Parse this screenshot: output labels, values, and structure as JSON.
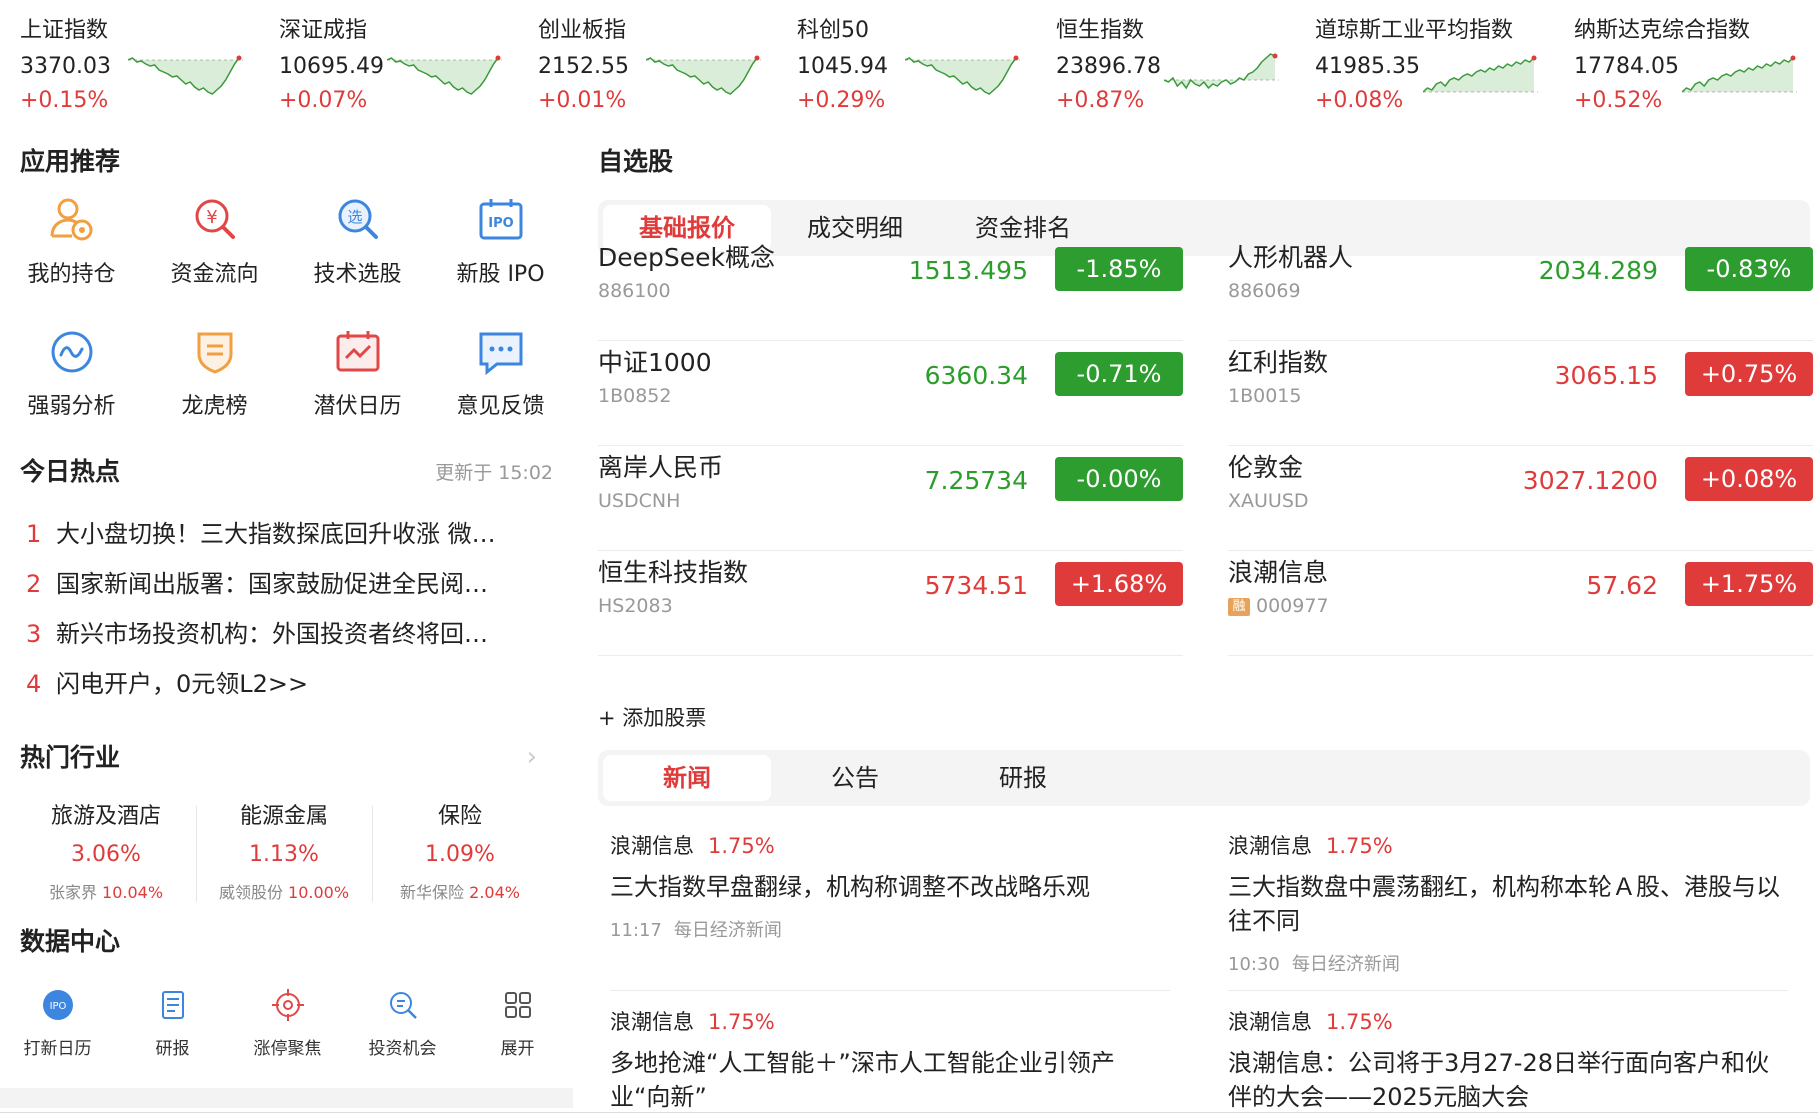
{
  "indices": [
    {
      "name": "上证指数",
      "value": "3370.03",
      "change": "+0.15%",
      "trend": "dip-recover"
    },
    {
      "name": "深证成指",
      "value": "10695.49",
      "change": "+0.07%",
      "trend": "dip-recover"
    },
    {
      "name": "创业板指",
      "value": "2152.55",
      "change": "+0.01%",
      "trend": "dip-recover"
    },
    {
      "name": "科创50",
      "value": "1045.94",
      "change": "+0.29%",
      "trend": "dip-recover"
    },
    {
      "name": "恒生指数",
      "value": "23896.78",
      "change": "+0.87%",
      "trend": "flat-spike"
    },
    {
      "name": "道琼斯工业平均指数",
      "value": "41985.35",
      "change": "+0.08%",
      "trend": "rise"
    },
    {
      "name": "纳斯达克综合指数",
      "value": "17784.05",
      "change": "+0.52%",
      "trend": "rise"
    }
  ],
  "apps": {
    "title": "应用推荐",
    "items": [
      {
        "label": "我的持仓",
        "icon": "user-holdings-icon"
      },
      {
        "label": "资金流向",
        "icon": "money-search-icon"
      },
      {
        "label": "技术选股",
        "icon": "stock-select-icon"
      },
      {
        "label": "新股 IPO",
        "icon": "ipo-icon"
      },
      {
        "label": "强弱分析",
        "icon": "wave-analysis-icon"
      },
      {
        "label": "龙虎榜",
        "icon": "shield-rank-icon"
      },
      {
        "label": "潜伏日历",
        "icon": "calendar-check-icon"
      },
      {
        "label": "意见反馈",
        "icon": "feedback-icon"
      }
    ]
  },
  "hot": {
    "title": "今日热点",
    "updated": "更新于 15:02",
    "items": [
      {
        "num": "1",
        "text": "大小盘切换！三大指数探底回升收涨 微…"
      },
      {
        "num": "2",
        "text": "国家新闻出版署：国家鼓励促进全民阅…"
      },
      {
        "num": "3",
        "text": "新兴市场投资机构：外国投资者终将回…"
      },
      {
        "num": "4",
        "text": "闪电开户，0元领L2>>"
      }
    ]
  },
  "industry": {
    "title": "热门行业",
    "arrow": "›",
    "items": [
      {
        "name": "旅游及酒店",
        "change": "3.06%",
        "leader": "张家界",
        "leader_change": "10.04%"
      },
      {
        "name": "能源金属",
        "change": "1.13%",
        "leader": "威领股份",
        "leader_change": "10.00%"
      },
      {
        "name": "保险",
        "change": "1.09%",
        "leader": "新华保险",
        "leader_change": "2.04%"
      }
    ]
  },
  "data_center": {
    "title": "数据中心",
    "items": [
      {
        "label": "打新日历",
        "icon": "ipo-badge-icon"
      },
      {
        "label": "研报",
        "icon": "report-icon"
      },
      {
        "label": "涨停聚焦",
        "icon": "target-icon"
      },
      {
        "label": "投资机会",
        "icon": "opportunity-search-icon"
      },
      {
        "label": "展开",
        "icon": "grid-expand-icon"
      }
    ]
  },
  "watchlist": {
    "title": "自选股",
    "tabs": [
      "基础报价",
      "成交明细",
      "资金排名"
    ],
    "active_tab": 0,
    "quotes": [
      {
        "name": "DeepSeek概念",
        "code": "886100",
        "price": "1513.495",
        "change": "-1.85%",
        "dir": "down"
      },
      {
        "name": "人形机器人",
        "code": "886069",
        "price": "2034.289",
        "change": "-0.83%",
        "dir": "down"
      },
      {
        "name": "中证1000",
        "code": "1B0852",
        "price": "6360.34",
        "change": "-0.71%",
        "dir": "down"
      },
      {
        "name": "红利指数",
        "code": "1B0015",
        "price": "3065.15",
        "change": "+0.75%",
        "dir": "up"
      },
      {
        "name": "离岸人民币",
        "code": "USDCNH",
        "price": "7.25734",
        "change": "-0.00%",
        "dir": "down"
      },
      {
        "name": "伦敦金",
        "code": "XAUUSD",
        "price": "3027.1200",
        "change": "+0.08%",
        "dir": "up"
      },
      {
        "name": "恒生科技指数",
        "code": "HS2083",
        "price": "5734.51",
        "change": "+1.68%",
        "dir": "up"
      },
      {
        "name": "浪潮信息",
        "code": "000977",
        "price": "57.62",
        "change": "+1.75%",
        "dir": "up",
        "tag": "融"
      }
    ],
    "add_label": "+ 添加股票"
  },
  "news": {
    "tabs": [
      "新闻",
      "公告",
      "研报"
    ],
    "active_tab": 0,
    "items": [
      {
        "source": "浪潮信息",
        "pct": "1.75%",
        "title": "三大指数早盘翻绿，机构称调整不改战略乐观",
        "time": "11:17",
        "outlet": "每日经济新闻"
      },
      {
        "source": "浪潮信息",
        "pct": "1.75%",
        "title": "三大指数盘中震荡翻红，机构称本轮Ａ股、港股与以往不同",
        "time": "10:30",
        "outlet": "每日经济新闻"
      },
      {
        "source": "浪潮信息",
        "pct": "1.75%",
        "title": "多地抢滩“人工智能＋”深市人工智能企业引领产业“向新”",
        "time": "",
        "outlet": ""
      },
      {
        "source": "浪潮信息",
        "pct": "1.75%",
        "title": "浪潮信息：公司将于3月27-28日举行面向客户和伙伴的大会——2025元脑大会",
        "time": "",
        "outlet": ""
      }
    ]
  },
  "colors": {
    "up": "#e03b3b",
    "down": "#2e9d2f",
    "accent": "#e03b3b"
  }
}
